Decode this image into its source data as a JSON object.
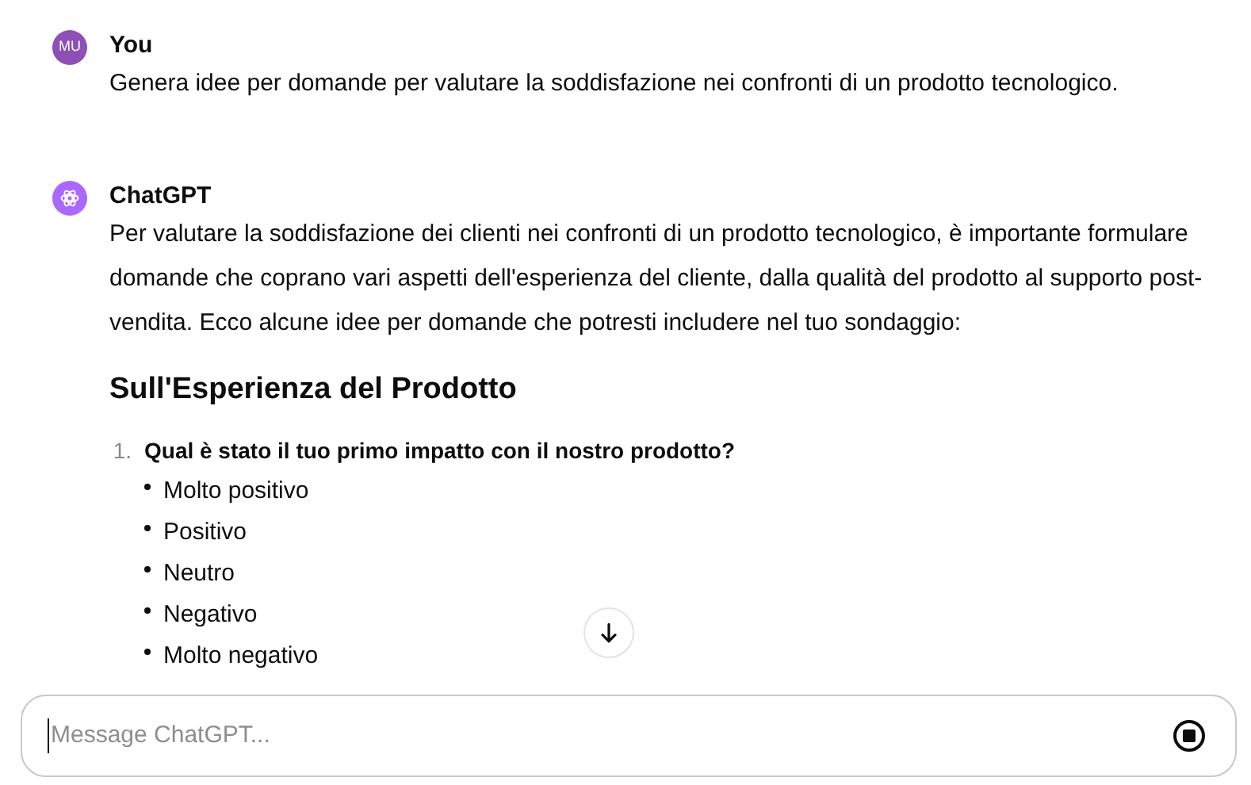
{
  "messages": [
    {
      "kind": "user",
      "avatar": "MU",
      "author": "You",
      "text": "Genera idee per domande per valutare la soddisfazione nei confronti di un prodotto tecnologico."
    },
    {
      "kind": "assistant",
      "author": "ChatGPT",
      "text": "Per valutare la soddisfazione dei clienti nei confronti di un prodotto tecnologico, è importante formulare domande che coprano vari aspetti dell'esperienza del cliente, dalla qualità del prodotto al supporto post-vendita. Ecco alcune idee per domande che potresti includere nel tuo sondaggio:",
      "heading": "Sull'Esperienza del Prodotto",
      "questions": [
        {
          "number": "1.",
          "text": "Qual è stato il tuo primo impatto con il nostro prodotto?",
          "options": [
            "Molto positivo",
            "Positivo",
            "Neutro",
            "Negativo",
            "Molto negativo"
          ]
        }
      ]
    }
  ],
  "composer": {
    "placeholder": "Message ChatGPT..."
  }
}
